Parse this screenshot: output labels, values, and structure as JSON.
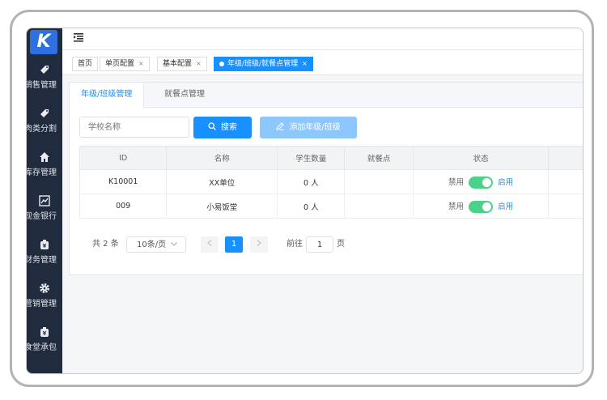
{
  "app": {
    "logo_text": "K"
  },
  "sidebar": {
    "items": [
      {
        "label": "销售管理",
        "icon": "tag-icon"
      },
      {
        "label": "肉类分割",
        "icon": "tag-icon"
      },
      {
        "label": "库存管理",
        "icon": "home-icon"
      },
      {
        "label": "现金银行",
        "icon": "chart-icon"
      },
      {
        "label": "财务管理",
        "icon": "finance-icon"
      },
      {
        "label": "营销管理",
        "icon": "gear-icon"
      },
      {
        "label": "食堂承包",
        "icon": "finance-icon"
      }
    ]
  },
  "tabs": [
    {
      "label": "首页",
      "closable": false
    },
    {
      "label": "单页配置",
      "closable": true
    },
    {
      "label": "基本配置",
      "closable": true
    },
    {
      "label": "年级/班级/就餐点管理",
      "closable": true,
      "active": true
    }
  ],
  "close_glyph": "×",
  "content_tabs": [
    {
      "label": "年级/班级管理"
    },
    {
      "label": "就餐点管理"
    }
  ],
  "search": {
    "placeholder": "学校名称",
    "button": "搜索",
    "add_button": "添加年级/班级"
  },
  "table": {
    "headers": [
      "ID",
      "名称",
      "学生数量",
      "就餐点",
      "状态"
    ],
    "rows": [
      {
        "id": "K10001",
        "name": "XX单位",
        "count": "0 人",
        "meal_point": "",
        "status_off": "禁用",
        "status_on": "启用",
        "enabled": true
      },
      {
        "id": "009",
        "name": "小易饭堂",
        "count": "0 人",
        "meal_point": "",
        "status_off": "禁用",
        "status_on": "启用",
        "enabled": true
      }
    ]
  },
  "pagination": {
    "total": "共 2 条",
    "page_size": "10条/页",
    "current": "1",
    "goto_label": "前往",
    "goto_value": "1",
    "page_unit": "页"
  },
  "colors": {
    "primary": "#1890ff",
    "switch_on": "#4cd18b",
    "sidebar_bg": "#202b3e"
  }
}
